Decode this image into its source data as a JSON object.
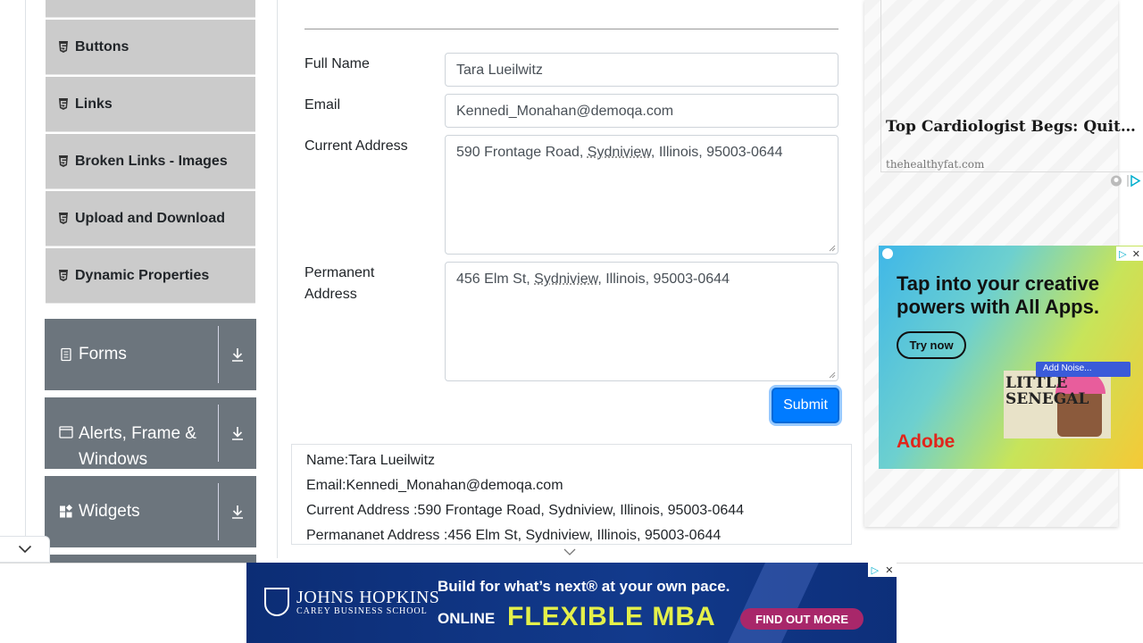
{
  "sidebar": {
    "items": [
      {
        "label": "Buttons"
      },
      {
        "label": "Links"
      },
      {
        "label": "Broken Links - Images"
      },
      {
        "label": "Upload and Download"
      },
      {
        "label": "Dynamic Properties"
      }
    ],
    "groups": [
      {
        "label": "Forms",
        "icon": "document-icon"
      },
      {
        "label": "Alerts, Frame &",
        "label2": "Windows",
        "icon": "window-icon"
      },
      {
        "label": "Widgets",
        "icon": "widgets-icon"
      }
    ]
  },
  "form": {
    "full_name_label": "Full Name",
    "full_name_value": "Tara Lueilwitz",
    "email_label": "Email",
    "email_value": "Kennedi_Monahan@demoqa.com",
    "current_address_label": "Current Address",
    "current_address_pre": "590 Frontage Road, ",
    "current_address_city": "Sydniview",
    "current_address_post": ", Illinois, 95003-0644",
    "permanent_address_label_1": "Permanent",
    "permanent_address_label_2": "Address",
    "permanent_address_pre": "456 Elm St, ",
    "permanent_address_city": "Sydniview",
    "permanent_address_post": ", Illinois, 95003-0644",
    "submit_label": "Submit"
  },
  "output": {
    "name": "Name:Tara Lueilwitz",
    "email": "Email:Kennedi_Monahan@demoqa.com",
    "current_address": "Current Address :590 Frontage Road, Sydniview, Illinois, 95003-0644",
    "permanent_address": "Permananet Address :456 Elm St, Sydniview, Illinois, 95003-0644"
  },
  "ads": {
    "native_headline": "Top Cardiologist Begs: Quit Eating Blueberries Before Th...",
    "native_source": "thehealthyfat.com",
    "adobe_headline_1": "Tap into your creative",
    "adobe_headline_2": "powers with All Apps.",
    "adobe_cta": "Try now",
    "adobe_brand": "Adobe",
    "adobe_noise": "Add Noise...",
    "adobe_poster_1": "LITTLE",
    "adobe_poster_2": "SENEGAL",
    "banner_logo_1": "JOHNS HOPKINS",
    "banner_logo_2": "CAREY BUSINESS SCHOOL",
    "banner_line_1": "Build for what’s next® at your own pace.",
    "banner_line_2a": "ONLINE",
    "banner_line_2b": "FLEXIBLE MBA",
    "banner_cta": "FIND OUT MORE"
  },
  "colors": {
    "submit": "#007bff",
    "sidebar_item": "#cbcbcb",
    "group_header": "#6c757d",
    "banner_bg": "#0c2d75",
    "banner_accent": "#e4f04a",
    "adobe_red": "#e1251b"
  }
}
